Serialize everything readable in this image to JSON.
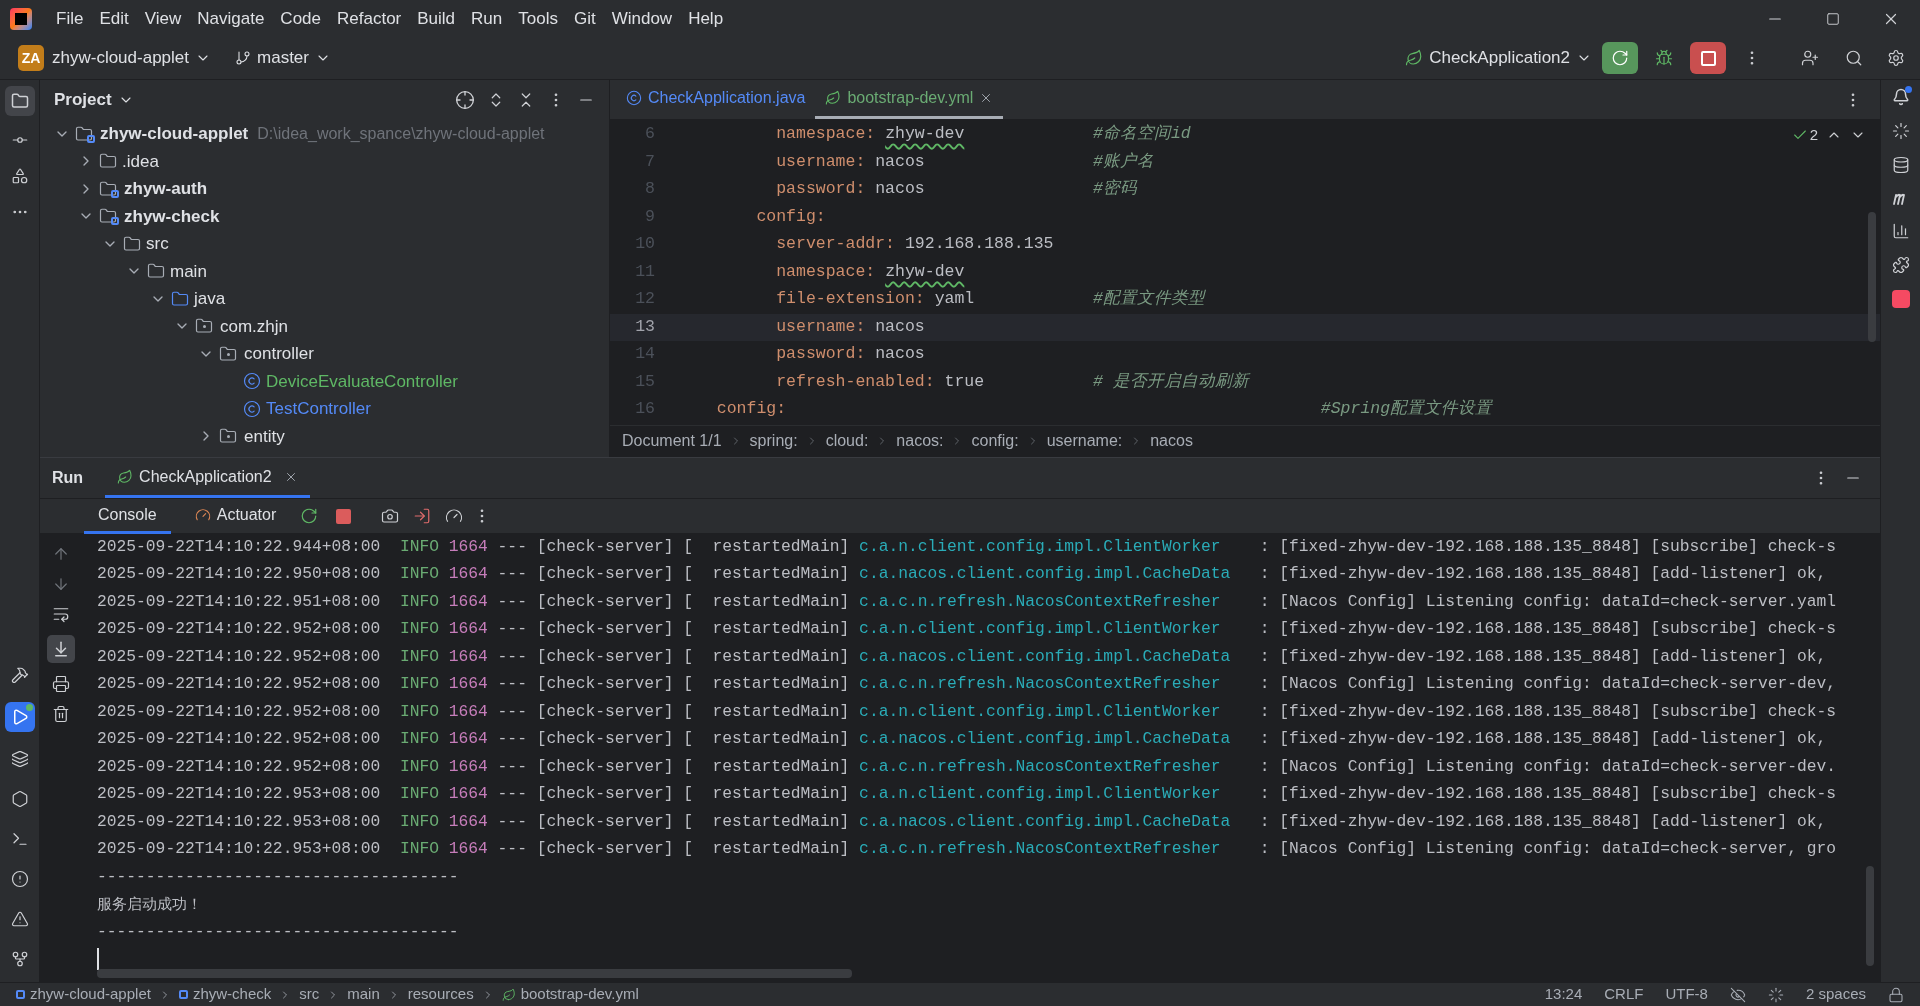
{
  "menu": [
    "File",
    "Edit",
    "View",
    "Navigate",
    "Code",
    "Refactor",
    "Build",
    "Run",
    "Tools",
    "Git",
    "Window",
    "Help"
  ],
  "toolbar": {
    "project_badge": "ZA",
    "project": "zhyw-cloud-applet",
    "branch": "master",
    "run_config": "CheckApplication2"
  },
  "project_panel": {
    "title": "Project",
    "tree": [
      {
        "kind": "module",
        "label": "zhyw-cloud-applet",
        "path": "D:\\idea_work_spance\\zhyw-cloud-applet",
        "expanded": true,
        "children": [
          {
            "kind": "folder",
            "label": ".idea",
            "expanded": false
          },
          {
            "kind": "module",
            "label": "zhyw-auth",
            "expanded": false
          },
          {
            "kind": "module",
            "label": "zhyw-check",
            "expanded": true,
            "children": [
              {
                "kind": "folder",
                "label": "src",
                "expanded": true,
                "children": [
                  {
                    "kind": "folder",
                    "label": "main",
                    "expanded": true,
                    "children": [
                      {
                        "kind": "source",
                        "label": "java",
                        "expanded": true,
                        "children": [
                          {
                            "kind": "package",
                            "label": "com.zhjn",
                            "expanded": true,
                            "children": [
                              {
                                "kind": "package",
                                "label": "controller",
                                "expanded": true,
                                "children": [
                                  {
                                    "kind": "class",
                                    "label": "DeviceEvaluateController",
                                    "color": "#5fb865"
                                  },
                                  {
                                    "kind": "class",
                                    "label": "TestController",
                                    "color": "#548af7"
                                  }
                                ]
                              },
                              {
                                "kind": "package",
                                "label": "entity",
                                "expanded": false
                              }
                            ]
                          }
                        ]
                      }
                    ]
                  }
                ]
              }
            ]
          }
        ]
      }
    ]
  },
  "editor": {
    "tabs": [
      {
        "label": "CheckApplication.java",
        "kind": "java",
        "selected": false
      },
      {
        "label": "bootstrap-dev.yml",
        "kind": "yaml",
        "selected": true
      }
    ],
    "inspection_count": "2",
    "lines": [
      {
        "number": "6",
        "kind": "entry",
        "key": "namespace:",
        "value": "zhyw-dev",
        "spell_warning": true,
        "comment": "#命名空间id",
        "current": false
      },
      {
        "number": "7",
        "kind": "entry",
        "key": "username:",
        "value": "nacos",
        "spell_warning": false,
        "comment": "#账户名",
        "current": false
      },
      {
        "number": "8",
        "kind": "entry",
        "key": "password:",
        "value": "nacos",
        "spell_warning": false,
        "comment": "#密码",
        "current": false
      },
      {
        "number": "9",
        "kind": "section",
        "key": "config:",
        "current": false
      },
      {
        "number": "10",
        "kind": "entry",
        "key": "server-addr:",
        "value": "192.168.188.135",
        "spell_warning": false,
        "current": false
      },
      {
        "number": "11",
        "kind": "entry",
        "key": "namespace:",
        "value": "zhyw-dev",
        "spell_warning": true,
        "current": false
      },
      {
        "number": "12",
        "kind": "entry",
        "key": "file-extension:",
        "value": "yaml",
        "spell_warning": false,
        "comment": "#配置文件类型",
        "current": false
      },
      {
        "number": "13",
        "kind": "entry",
        "key": "username:",
        "value": "nacos",
        "spell_warning": false,
        "current": true
      },
      {
        "number": "14",
        "kind": "entry",
        "key": "password:",
        "value": "nacos",
        "spell_warning": false,
        "current": false
      },
      {
        "number": "15",
        "kind": "entry",
        "key": "refresh-enabled:",
        "value": "true",
        "spell_warning": false,
        "comment": "# 是否开启自动刷新",
        "current": false
      },
      {
        "number": "16",
        "kind": "top",
        "key": "config:",
        "comment": "#Spring配置文件设置",
        "current": false
      }
    ],
    "breadcrumbs": [
      "Document 1/1",
      "spring:",
      "cloud:",
      "nacos:",
      "config:",
      "username:",
      "nacos"
    ]
  },
  "run_panel": {
    "title": "Run",
    "tabs": [
      {
        "label": "CheckApplication2",
        "selected": true
      }
    ],
    "console_tabs": [
      {
        "label": "Console",
        "kind": "console",
        "selected": true
      },
      {
        "label": "Actuator",
        "kind": "actuator",
        "selected": false
      }
    ],
    "log": [
      {
        "time": "2025-09-22T14:10:22.944+08:00",
        "level": "INFO",
        "pid": "1664",
        "sep": "---",
        "app": "[check-server]",
        "thread": "[  restartedMain]",
        "logger": "c.a.n.client.config.impl.ClientWorker",
        "delimiter": ":",
        "message": "[fixed-zhyw-dev-192.168.188.135_8848] [subscribe] check-s"
      },
      {
        "time": "2025-09-22T14:10:22.950+08:00",
        "level": "INFO",
        "pid": "1664",
        "sep": "---",
        "app": "[check-server]",
        "thread": "[  restartedMain]",
        "logger": "c.a.nacos.client.config.impl.CacheData",
        "delimiter": ":",
        "message": "[fixed-zhyw-dev-192.168.188.135_8848] [add-listener] ok,"
      },
      {
        "time": "2025-09-22T14:10:22.951+08:00",
        "level": "INFO",
        "pid": "1664",
        "sep": "---",
        "app": "[check-server]",
        "thread": "[  restartedMain]",
        "logger": "c.a.c.n.refresh.NacosContextRefresher",
        "delimiter": ":",
        "message": "[Nacos Config] Listening config: dataId=check-server.yaml"
      },
      {
        "time": "2025-09-22T14:10:22.952+08:00",
        "level": "INFO",
        "pid": "1664",
        "sep": "---",
        "app": "[check-server]",
        "thread": "[  restartedMain]",
        "logger": "c.a.n.client.config.impl.ClientWorker",
        "delimiter": ":",
        "message": "[fixed-zhyw-dev-192.168.188.135_8848] [subscribe] check-s"
      },
      {
        "time": "2025-09-22T14:10:22.952+08:00",
        "level": "INFO",
        "pid": "1664",
        "sep": "---",
        "app": "[check-server]",
        "thread": "[  restartedMain]",
        "logger": "c.a.nacos.client.config.impl.CacheData",
        "delimiter": ":",
        "message": "[fixed-zhyw-dev-192.168.188.135_8848] [add-listener] ok,"
      },
      {
        "time": "2025-09-22T14:10:22.952+08:00",
        "level": "INFO",
        "pid": "1664",
        "sep": "---",
        "app": "[check-server]",
        "thread": "[  restartedMain]",
        "logger": "c.a.c.n.refresh.NacosContextRefresher",
        "delimiter": ":",
        "message": "[Nacos Config] Listening config: dataId=check-server-dev,"
      },
      {
        "time": "2025-09-22T14:10:22.952+08:00",
        "level": "INFO",
        "pid": "1664",
        "sep": "---",
        "app": "[check-server]",
        "thread": "[  restartedMain]",
        "logger": "c.a.n.client.config.impl.ClientWorker",
        "delimiter": ":",
        "message": "[fixed-zhyw-dev-192.168.188.135_8848] [subscribe] check-s"
      },
      {
        "time": "2025-09-22T14:10:22.952+08:00",
        "level": "INFO",
        "pid": "1664",
        "sep": "---",
        "app": "[check-server]",
        "thread": "[  restartedMain]",
        "logger": "c.a.nacos.client.config.impl.CacheData",
        "delimiter": ":",
        "message": "[fixed-zhyw-dev-192.168.188.135_8848] [add-listener] ok,"
      },
      {
        "time": "2025-09-22T14:10:22.952+08:00",
        "level": "INFO",
        "pid": "1664",
        "sep": "---",
        "app": "[check-server]",
        "thread": "[  restartedMain]",
        "logger": "c.a.c.n.refresh.NacosContextRefresher",
        "delimiter": ":",
        "message": "[Nacos Config] Listening config: dataId=check-server-dev."
      },
      {
        "time": "2025-09-22T14:10:22.953+08:00",
        "level": "INFO",
        "pid": "1664",
        "sep": "---",
        "app": "[check-server]",
        "thread": "[  restartedMain]",
        "logger": "c.a.n.client.config.impl.ClientWorker",
        "delimiter": ":",
        "message": "[fixed-zhyw-dev-192.168.188.135_8848] [subscribe] check-s"
      },
      {
        "time": "2025-09-22T14:10:22.953+08:00",
        "level": "INFO",
        "pid": "1664",
        "sep": "---",
        "app": "[check-server]",
        "thread": "[  restartedMain]",
        "logger": "c.a.nacos.client.config.impl.CacheData",
        "delimiter": ":",
        "message": "[fixed-zhyw-dev-192.168.188.135_8848] [add-listener] ok,"
      },
      {
        "time": "2025-09-22T14:10:22.953+08:00",
        "level": "INFO",
        "pid": "1664",
        "sep": "---",
        "app": "[check-server]",
        "thread": "[  restartedMain]",
        "logger": "c.a.c.n.refresh.NacosContextRefresher",
        "delimiter": ":",
        "message": "[Nacos Config] Listening config: dataId=check-server, gro"
      }
    ],
    "output": [
      "-------------------------------------",
      "服务启动成功！",
      "-------------------------------------"
    ]
  },
  "status_bar": {
    "path": [
      "zhyw-cloud-applet",
      "zhyw-check",
      "src",
      "main",
      "resources",
      "bootstrap-dev.yml"
    ],
    "position": "13:24",
    "line_separator": "CRLF",
    "encoding": "UTF-8",
    "indent": "2 spaces"
  }
}
